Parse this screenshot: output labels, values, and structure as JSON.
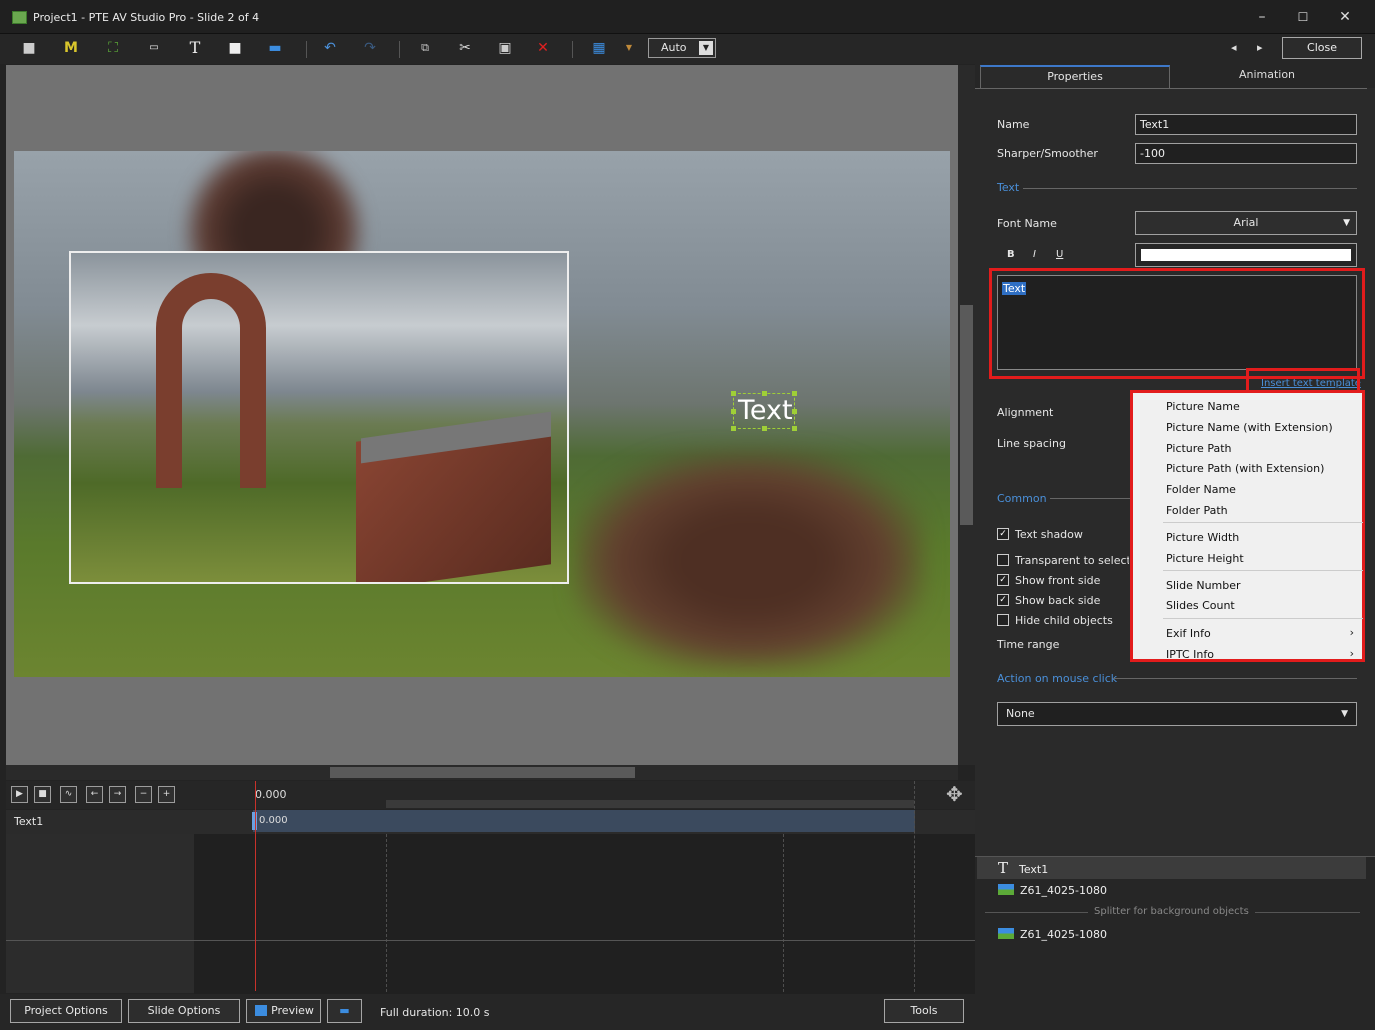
{
  "window": {
    "title": "Project1 - PTE AV Studio Pro - Slide 2 of 4",
    "minimize": "–",
    "maximize": "☐",
    "close": "✕"
  },
  "toolbar": {
    "zoom": "Auto",
    "close_label": "Close",
    "prev": "◂",
    "next": "▸"
  },
  "canvas": {
    "text_object": "Text"
  },
  "timeline": {
    "ruler_start": "0.000",
    "row_name": "Text1",
    "clip_start": "0.000"
  },
  "bottom": {
    "project_options": "Project Options",
    "slide_options": "Slide Options",
    "preview": "Preview",
    "full_duration": "Full duration: 10.0 s",
    "tools": "Tools"
  },
  "tabs": {
    "properties": "Properties",
    "animation": "Animation"
  },
  "properties": {
    "name_label": "Name",
    "name_value": "Text1",
    "sharper_label": "Sharper/Smoother",
    "sharper_value": "-100",
    "text_section": "Text",
    "font_label": "Font Name",
    "font_value": "Arial",
    "bold": "B",
    "italic": "I",
    "underline": "U",
    "text_value": "Text",
    "insert_template": "Insert text template",
    "alignment_label": "Alignment",
    "line_spacing_label": "Line spacing",
    "common_section": "Common",
    "text_shadow": "Text shadow",
    "transparent": "Transparent to selection",
    "show_front": "Show front side",
    "show_back": "Show back side",
    "hide_child": "Hide child objects",
    "time_range": "Time range",
    "action_section": "Action on mouse click",
    "action_value": "None"
  },
  "menu": {
    "items": [
      "Picture Name",
      "Picture Name (with Extension)",
      "Picture Path",
      "Picture Path (with Extension)",
      "Folder Name",
      "Folder Path",
      "Picture Width",
      "Picture Height",
      "Slide Number",
      "Slides Count",
      "Exif Info",
      "IPTC Info"
    ],
    "submenu_arrow": "›"
  },
  "objects": {
    "text1": "Text1",
    "img1": "Z61_4025-1080",
    "splitter": "Splitter for background objects",
    "img2": "Z61_4025-1080"
  }
}
